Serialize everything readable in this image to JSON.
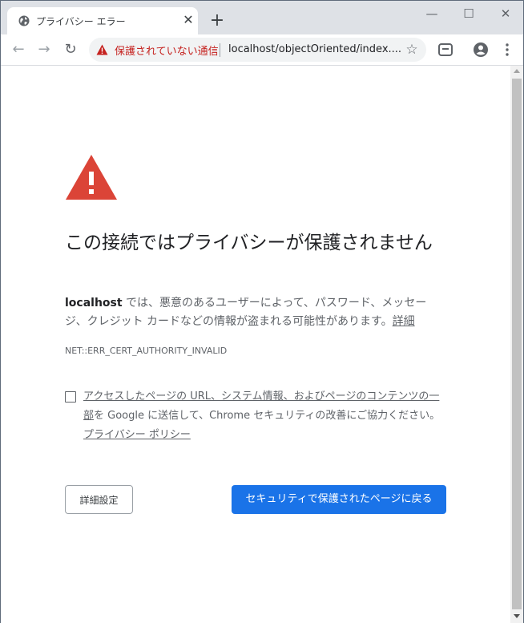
{
  "browser": {
    "tab_title": "プライバシー エラー",
    "tab_close": "✕",
    "new_tab": "+",
    "window_controls": {
      "minimize": "—",
      "maximize": "☐",
      "close": "✕"
    },
    "nav": {
      "back": "←",
      "forward": "→",
      "reload": "↻"
    },
    "omnibox": {
      "security_label": "保護されていない通信",
      "url": "localhost/objectOriented/index....",
      "bookmark_star": "☆"
    },
    "icons": [
      "globe-icon",
      "warning-icon",
      "star-icon",
      "extension-icon",
      "account-icon",
      "menu-icon"
    ]
  },
  "page": {
    "heading": "この接続ではプライバシーが保護されません",
    "description_host": "localhost",
    "description_text": " では、悪意のあるユーザーによって、パスワード、メッセージ、クレジット カードなどの情報が盗まれる可能性があります。",
    "details_link": "詳細",
    "error_code": "NET::ERR_CERT_AUTHORITY_INVALID",
    "checkbox": {
      "checked": false,
      "text_link_part": "アクセスしたページの URL、システム情報、およびページのコンテンツの一部",
      "text_plain_part": "を Google に送信して、Chrome セキュリティの改善にご協力ください。",
      "privacy_link": "プライバシー ポリシー"
    },
    "advanced_button": "詳細設定",
    "back_button": "セキュリティで保護されたページに戻る"
  },
  "colors": {
    "warning_red": "#db4437",
    "security_text": "#c5221f",
    "primary_button": "#1a73e8",
    "titlebar": "#dee1e6"
  }
}
